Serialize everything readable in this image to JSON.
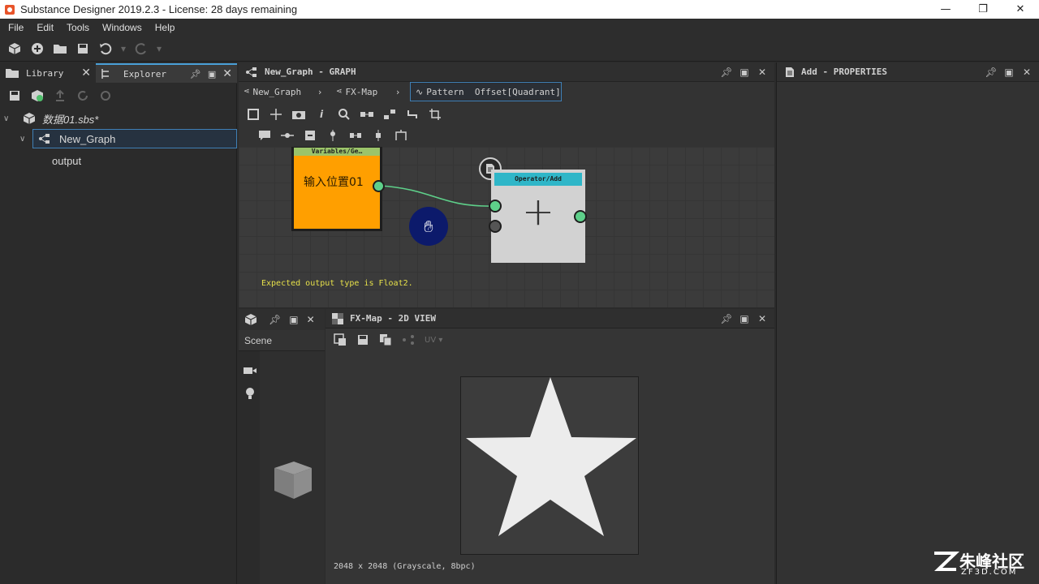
{
  "window": {
    "title": "Substance Designer 2019.2.3 - License: 28 days remaining",
    "controls": [
      "—",
      "❐",
      "✕"
    ]
  },
  "menu": [
    "File",
    "Edit",
    "Tools",
    "Windows",
    "Help"
  ],
  "left_panel": {
    "tabs": [
      "Library",
      "Explorer"
    ],
    "tree": {
      "package": "数据01.sbs*",
      "graph": "New_Graph",
      "output": "output"
    }
  },
  "graph_panel": {
    "title": "New_Graph - GRAPH",
    "breadcrumbs": [
      "New_Graph",
      "FX-Map",
      "Pattern  Offset[Quadrant]"
    ],
    "nodes": {
      "variable_header": "Variables/Ge…",
      "variable_label": "输入位置01",
      "add_header": "Operator/Add",
      "add_symbol": "+"
    },
    "warning": "Expected output type is Float2."
  },
  "properties_panel": {
    "title": "Add - PROPERTIES"
  },
  "scene_panel": {
    "label": "Scene"
  },
  "view_panel": {
    "title": "FX-Map - 2D VIEW",
    "uv_label": "UV",
    "status": "2048 x 2048 (Grayscale, 8bpc)"
  },
  "watermark": {
    "text": "朱峰社区",
    "sub": "ZF3D.COM"
  },
  "colors": {
    "accent": "#4aa0d8",
    "node_orange": "#ff9f00",
    "node_green_header": "#9bc46a",
    "node_cyan_header": "#2fb6c8",
    "connector": "#5ed08a",
    "warning_text": "#e6e04a"
  }
}
